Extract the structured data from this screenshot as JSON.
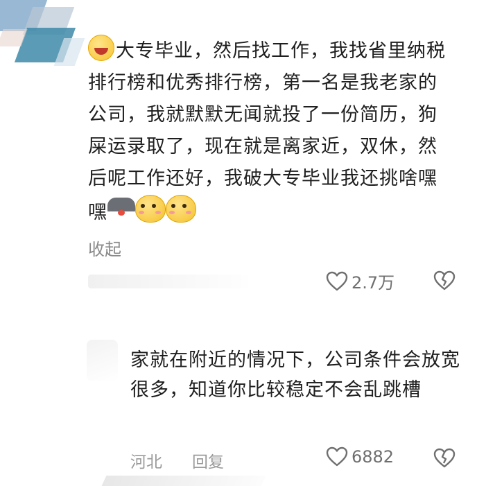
{
  "main_comment": {
    "text": "大专毕业，然后找工作，我找省里纳税排行榜和优秀排行榜，第一名是我老家的公司，我就默默无闻就投了一份简历，狗屎运录取了，现在就是离家近，双休，然后呢工作还好，我破大专毕业我还挑啥嘿嘿",
    "collapse_label": "收起",
    "like_count": "2.7万",
    "emojis": [
      "laughing-face-icon",
      "husky-dog-icon",
      "shy-face-icon",
      "shy-face-icon"
    ]
  },
  "reply": {
    "text": "家就在附近的情况下，公司条件会放宽很多，知道你比较稳定不会乱跳槽",
    "location": "河北",
    "reply_label": "回复",
    "like_count": "6882"
  },
  "colors": {
    "text": "#1f1f1f",
    "muted": "#8a8a8a",
    "icon": "#6f6f6f"
  }
}
